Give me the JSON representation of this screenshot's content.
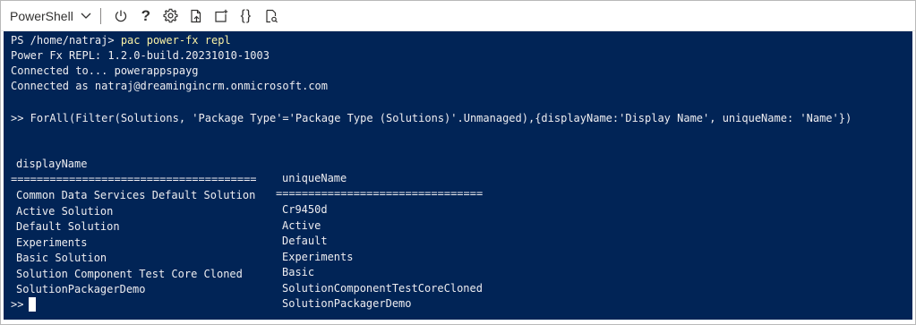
{
  "toolbar": {
    "shell_label": "PowerShell",
    "icons": [
      "chevron-down-icon",
      "power-icon",
      "help-icon",
      "gear-icon",
      "upload-icon",
      "new-session-icon",
      "editor-braces-icon",
      "web-preview-icon"
    ],
    "braces_glyph": "{}",
    "help_glyph": "?"
  },
  "terminal": {
    "prompt": "PS /home/natraj>",
    "command": "pac power-fx repl",
    "repl_version": "Power Fx REPL: 1.2.0-build.20231010-1003",
    "connected_to": "Connected to... powerappspayg",
    "connected_as": "Connected as natraj@dreamingincrm.onmicrosoft.com",
    "query": ">> ForAll(Filter(Solutions, 'Package Type'='Package Type (Solutions)'.Unmanaged),{displayName:'Display Name', uniqueName: 'Name'})",
    "table": {
      "headers": [
        "displayName",
        "uniqueName"
      ],
      "separators": [
        "======================================",
        "================================"
      ],
      "rows": [
        [
          "Common Data Services Default Solution",
          "Cr9450d"
        ],
        [
          "Active Solution",
          "Active"
        ],
        [
          "Default Solution",
          "Default"
        ],
        [
          "Experiments",
          "Experiments"
        ],
        [
          "Basic Solution",
          "Basic"
        ],
        [
          "Solution Component Test Core Cloned",
          "SolutionComponentTestCoreCloned"
        ],
        [
          "SolutionPackagerDemo",
          "SolutionPackagerDemo"
        ]
      ]
    },
    "final_prompt": ">>"
  },
  "colors": {
    "terminal_bg": "#012456",
    "terminal_fg": "#eeedf0",
    "command_highlight": "#f9f1a5"
  }
}
